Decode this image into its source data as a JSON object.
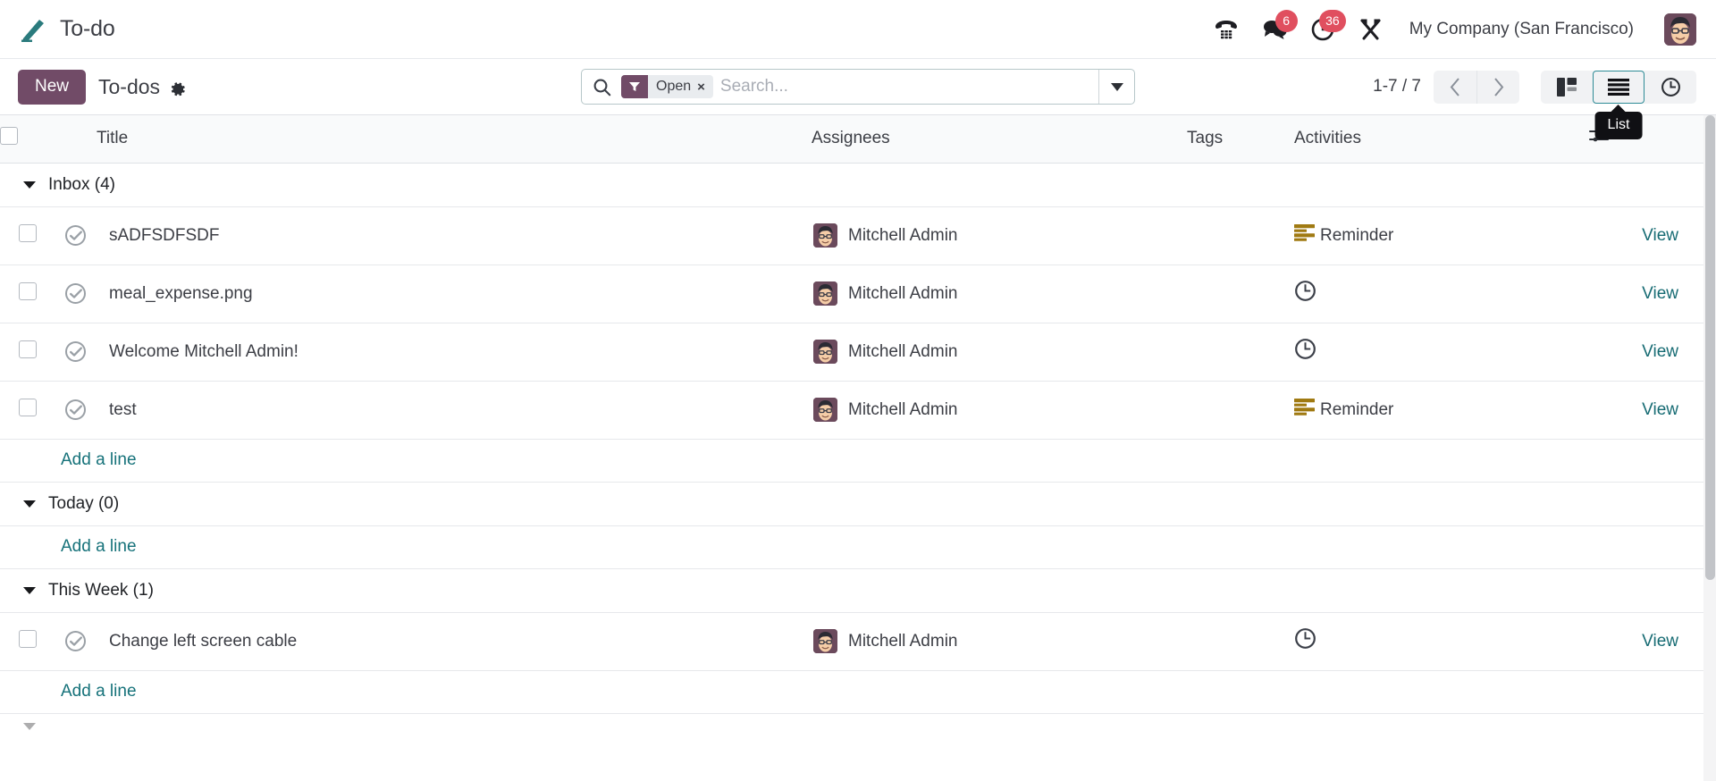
{
  "app": {
    "name": "To-do",
    "logo_icon": "pencil-icon"
  },
  "navbar": {
    "icons": [
      {
        "name": "phone-dialpad-icon",
        "badge": null
      },
      {
        "name": "messages-icon",
        "badge": "6"
      },
      {
        "name": "activities-clock-icon",
        "badge": "36"
      },
      {
        "name": "tools-icon",
        "badge": null
      }
    ],
    "company": "My Company (San Francisco)",
    "avatar_name": "user-avatar"
  },
  "control_panel": {
    "new_label": "New",
    "breadcrumb": "To-dos",
    "gear_icon": "gear-icon",
    "search": {
      "search_icon": "search-icon",
      "facet": {
        "icon": "filter-funnel-icon",
        "label": "Open",
        "remove": "×"
      },
      "placeholder": "Search...",
      "value": "",
      "dropdown_icon": "chevron-down-icon"
    },
    "pager": {
      "count": "1-7 / 7",
      "prev_icon": "chevron-left-icon",
      "next_icon": "chevron-right-icon"
    },
    "views": [
      {
        "name": "kanban",
        "icon": "kanban-icon",
        "active": false
      },
      {
        "name": "list",
        "icon": "list-icon",
        "active": true
      },
      {
        "name": "activity",
        "icon": "clock-icon",
        "active": false
      }
    ],
    "tooltip": "List"
  },
  "table": {
    "headers": {
      "select_all": "select-all-checkbox",
      "title": "Title",
      "assignees": "Assignees",
      "tags": "Tags",
      "activities": "Activities",
      "options_icon": "column-options-icon"
    },
    "groups": [
      {
        "label": "Inbox (4)",
        "rows": [
          {
            "title": "sADFSDFSDF",
            "assignee": "Mitchell Admin",
            "tags": "",
            "activity_icon": "reminder-icon",
            "activity": "Reminder",
            "action": "View"
          },
          {
            "title": "meal_expense.png",
            "assignee": "Mitchell Admin",
            "tags": "",
            "activity_icon": "clock-icon",
            "activity": "",
            "action": "View"
          },
          {
            "title": "Welcome Mitchell Admin!",
            "assignee": "Mitchell Admin",
            "tags": "",
            "activity_icon": "clock-icon",
            "activity": "",
            "action": "View"
          },
          {
            "title": "test",
            "assignee": "Mitchell Admin",
            "tags": "",
            "activity_icon": "reminder-icon",
            "activity": "Reminder",
            "action": "View"
          }
        ],
        "add_line": "Add a line"
      },
      {
        "label": "Today (0)",
        "rows": [],
        "add_line": "Add a line"
      },
      {
        "label": "This Week (1)",
        "rows": [
          {
            "title": "Change left screen cable",
            "assignee": "Mitchell Admin",
            "tags": "",
            "activity_icon": "clock-icon",
            "activity": "",
            "action": "View"
          }
        ],
        "add_line": "Add a line"
      }
    ]
  },
  "colors": {
    "brand_purple": "#714b67",
    "accent_teal": "#16727a",
    "badge_red": "#e04f5f",
    "reminder_gold": "#a07a12",
    "logo_teal": "#2a7b7d"
  }
}
